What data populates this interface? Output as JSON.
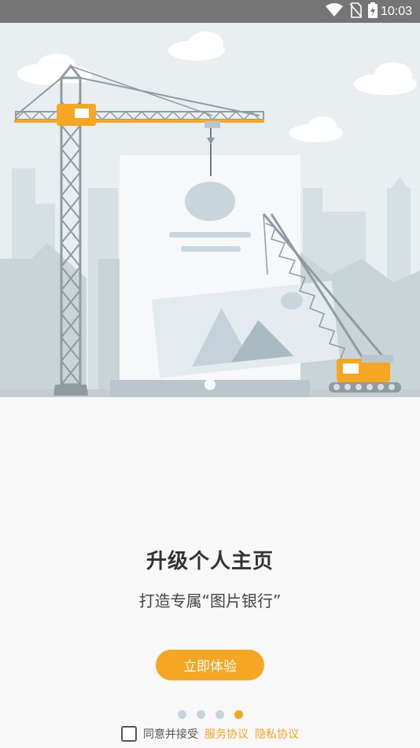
{
  "status_bar": {
    "time": "10:03",
    "icons": [
      "wifi-icon",
      "no-sim-icon",
      "battery-charging-icon"
    ]
  },
  "onboarding": {
    "title": "升级个人主页",
    "subtitle": "打造专属“图片银行”",
    "cta_label": "立即体验",
    "page_count": 4,
    "active_page": 4
  },
  "agreement": {
    "checked": false,
    "text": "同意并接受",
    "service_link": "服务协议",
    "privacy_link": "隐私协议"
  },
  "colors": {
    "accent": "#f5a623",
    "status_bar": "#757575",
    "background": "#f8f8f8",
    "hero_background": "#e9eef0"
  }
}
